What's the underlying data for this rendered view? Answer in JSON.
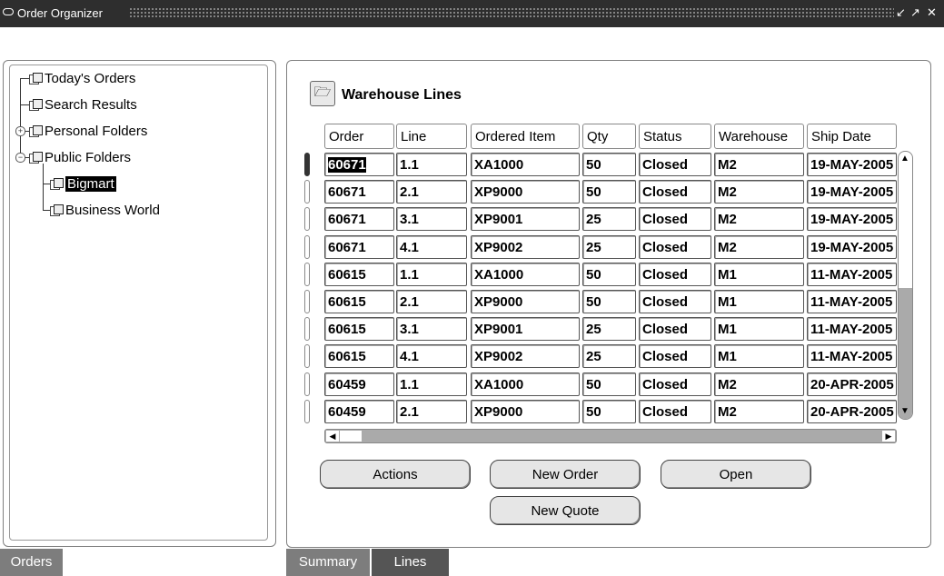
{
  "window": {
    "title": "Order Organizer",
    "buttons": [
      "↙",
      "↗",
      "✕"
    ]
  },
  "navigator": {
    "items": [
      {
        "label": "Today's Orders"
      },
      {
        "label": "Search Results"
      },
      {
        "label": "Personal Folders"
      },
      {
        "label": "Public Folders"
      },
      {
        "label": "Bigmart"
      },
      {
        "label": "Business World"
      }
    ],
    "tab": "Orders"
  },
  "summary": {
    "title": "Warehouse Lines",
    "columns": [
      "Order",
      "Line",
      "Ordered Item",
      "Qty",
      "Status",
      "Warehouse",
      "Ship Date"
    ],
    "rows": [
      [
        "60671",
        "1.1",
        "XA1000",
        "50",
        "Closed",
        "M2",
        "19-MAY-2005"
      ],
      [
        "60671",
        "2.1",
        "XP9000",
        "50",
        "Closed",
        "M2",
        "19-MAY-2005"
      ],
      [
        "60671",
        "3.1",
        "XP9001",
        "25",
        "Closed",
        "M2",
        "19-MAY-2005"
      ],
      [
        "60671",
        "4.1",
        "XP9002",
        "25",
        "Closed",
        "M2",
        "19-MAY-2005"
      ],
      [
        "60615",
        "1.1",
        "XA1000",
        "50",
        "Closed",
        "M1",
        "11-MAY-2005"
      ],
      [
        "60615",
        "2.1",
        "XP9000",
        "50",
        "Closed",
        "M1",
        "11-MAY-2005"
      ],
      [
        "60615",
        "3.1",
        "XP9001",
        "25",
        "Closed",
        "M1",
        "11-MAY-2005"
      ],
      [
        "60615",
        "4.1",
        "XP9002",
        "25",
        "Closed",
        "M1",
        "11-MAY-2005"
      ],
      [
        "60459",
        "1.1",
        "XA1000",
        "50",
        "Closed",
        "M2",
        "20-APR-2005"
      ],
      [
        "60459",
        "2.1",
        "XP9000",
        "50",
        "Closed",
        "M2",
        "20-APR-2005"
      ]
    ],
    "buttons": {
      "actions": "Actions",
      "new_order": "New Order",
      "open": "Open",
      "new_quote": "New Quote"
    },
    "tabs": [
      "Summary",
      "Lines"
    ]
  }
}
